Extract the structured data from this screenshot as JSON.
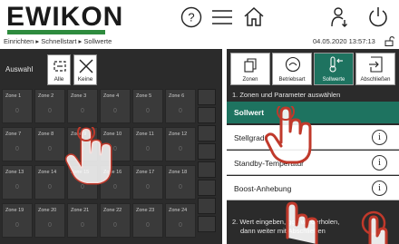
{
  "header": {
    "logo_text": "EWIKON",
    "brand_color": "#2e8b3e",
    "breadcrumb": "Einrichten ▸ Schnellstart ▸ Sollwerte",
    "datetime": "04.05.2020 13:57:13",
    "icons": [
      "help-icon",
      "menu-icon",
      "home-icon",
      "user-logout-icon",
      "power-icon",
      "lock-icon"
    ]
  },
  "selection": {
    "label": "Auswahl",
    "all_label": "Alle",
    "none_label": "Keine"
  },
  "zones": [
    {
      "name": "Zone 1",
      "value": "0"
    },
    {
      "name": "Zone 2",
      "value": "0"
    },
    {
      "name": "Zone 3",
      "value": "0"
    },
    {
      "name": "Zone 4",
      "value": "0"
    },
    {
      "name": "Zone 5",
      "value": "0"
    },
    {
      "name": "Zone 6",
      "value": "0"
    },
    {
      "name": "Zone 7",
      "value": "0"
    },
    {
      "name": "Zone 8",
      "value": "0"
    },
    {
      "name": "Zone 9",
      "value": "0"
    },
    {
      "name": "Zone 10",
      "value": "0"
    },
    {
      "name": "Zone 11",
      "value": "0"
    },
    {
      "name": "Zone 12",
      "value": "0"
    },
    {
      "name": "Zone 13",
      "value": "0"
    },
    {
      "name": "Zone 14",
      "value": "0"
    },
    {
      "name": "Zone 15",
      "value": "0"
    },
    {
      "name": "Zone 16",
      "value": "0"
    },
    {
      "name": "Zone 17",
      "value": "0"
    },
    {
      "name": "Zone 18",
      "value": "0"
    },
    {
      "name": "Zone 19",
      "value": "0"
    },
    {
      "name": "Zone 20",
      "value": "0"
    },
    {
      "name": "Zone 21",
      "value": "0"
    },
    {
      "name": "Zone 22",
      "value": "0"
    },
    {
      "name": "Zone 23",
      "value": "0"
    },
    {
      "name": "Zone 24",
      "value": "0"
    }
  ],
  "mode_buttons": [
    {
      "label": "Zonen",
      "icon": "zones-icon",
      "active": false
    },
    {
      "label": "Betriebsart",
      "icon": "operating-mode-icon",
      "active": false
    },
    {
      "label": "Sollwerte",
      "icon": "setpoint-icon",
      "active": true
    },
    {
      "label": "Abschließen",
      "icon": "finish-icon",
      "active": false
    }
  ],
  "accent_color": "#1e7360",
  "step1": "1. Zonen und Parameter auswählen",
  "parameter_header": "Sollwert",
  "parameters": [
    {
      "label": "Stellgrad"
    },
    {
      "label": "Standby-Temperatur"
    },
    {
      "label": "Boost-Anhebung"
    }
  ],
  "step2_line1": "2. Wert eingeben, ggf. wiederholen,",
  "step2_line2": "dann weiter mit Abschließen"
}
